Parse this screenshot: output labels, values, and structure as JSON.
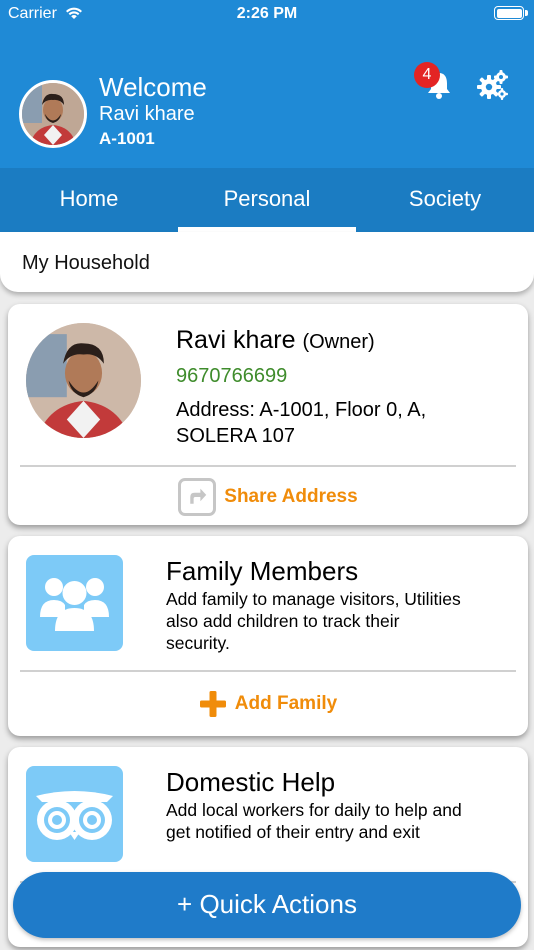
{
  "status_bar": {
    "carrier": "Carrier",
    "time": "2:26 PM"
  },
  "header": {
    "welcome": "Welcome",
    "user_name": "Ravi khare",
    "flat": "A-1001",
    "notification_count": "4"
  },
  "tabs": [
    {
      "label": "Home"
    },
    {
      "label": "Personal",
      "selected": true
    },
    {
      "label": "Society"
    }
  ],
  "section": {
    "title": "My Household"
  },
  "profile_card": {
    "name": "Ravi khare",
    "role": "(Owner)",
    "phone": "9670766699",
    "address": "Address:  A-1001, Floor 0, A, SOLERA 107",
    "action_label": "Share Address"
  },
  "family_card": {
    "title": "Family Members",
    "description": "Add family to manage visitors, Utilities also add children to track their security.",
    "action_label": "Add Family"
  },
  "help_card": {
    "title": "Domestic Help",
    "description": "Add local workers for daily to help and get notified of their entry and exit"
  },
  "fab": {
    "label": "+ Quick Actions"
  },
  "colors": {
    "header_blue": "#1f8ad6",
    "tab_bar_blue": "#1b7cc2",
    "accent_orange": "#f08c0a",
    "phone_green": "#3f8c2c",
    "tile_blue": "#7dcaf7",
    "badge_red": "#e32424"
  }
}
